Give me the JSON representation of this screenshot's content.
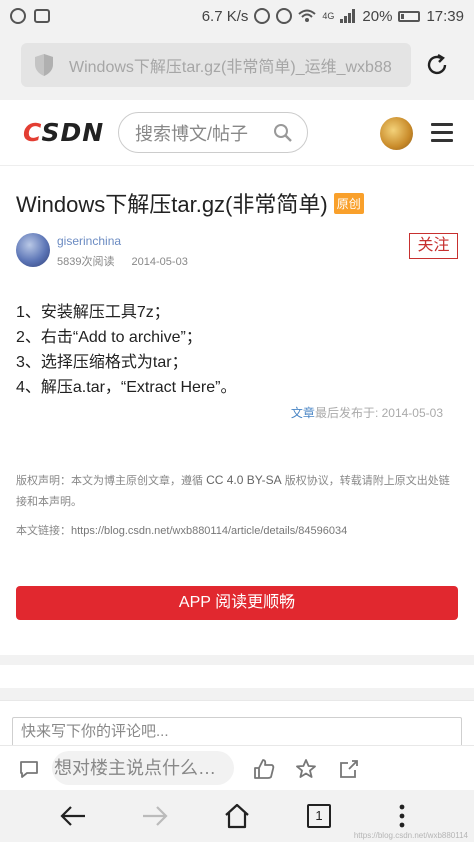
{
  "status_bar": {
    "network_speed": "6.7 K/s",
    "network_type": "4G",
    "battery": "20%",
    "time": "17:39"
  },
  "browser": {
    "url_text": "Windows下解压tar.gz(非常简单)_运维_wxb88",
    "tab_count": "1",
    "icons": [
      "shield-icon",
      "reload-icon",
      "back-icon",
      "forward-icon",
      "home-icon",
      "more-icon"
    ]
  },
  "site_header": {
    "logo": "CSDN",
    "search_placeholder": "搜索博文/帖子"
  },
  "article": {
    "title": "Windows下解压tar.gz(非常简单)",
    "badge": "原创",
    "author": "giserinchina",
    "read_count": "5839次阅读",
    "date": "2014-05-03",
    "follow_label": "关注",
    "lines": [
      "1、安装解压工具7z；",
      "2、右击“Add to archive”；",
      "3、选择压缩格式为tar；",
      "4、解压a.tar，“Extract Here”。"
    ],
    "post_info_link": "文章",
    "post_info_text": "最后发布于: 2014-05-03",
    "copyright_a": "版权声明：本文为博主原创文章，遵循 ",
    "copyright_license": "CC 4.0 BY-SA",
    "copyright_b": " 版权协议，转载请附上原文出处链接和本声明。",
    "link_label": "本文链接：",
    "link_url": "https://blog.csdn.net/wxb880114/article/details/84596034",
    "app_button": "APP 阅读更顺畅"
  },
  "comments": {
    "input_placeholder": "快来写下你的评论吧...",
    "toolbar_placeholder": "想对楼主说点什么…"
  },
  "watermark": "https://blog.csdn.net/wxb880114"
}
